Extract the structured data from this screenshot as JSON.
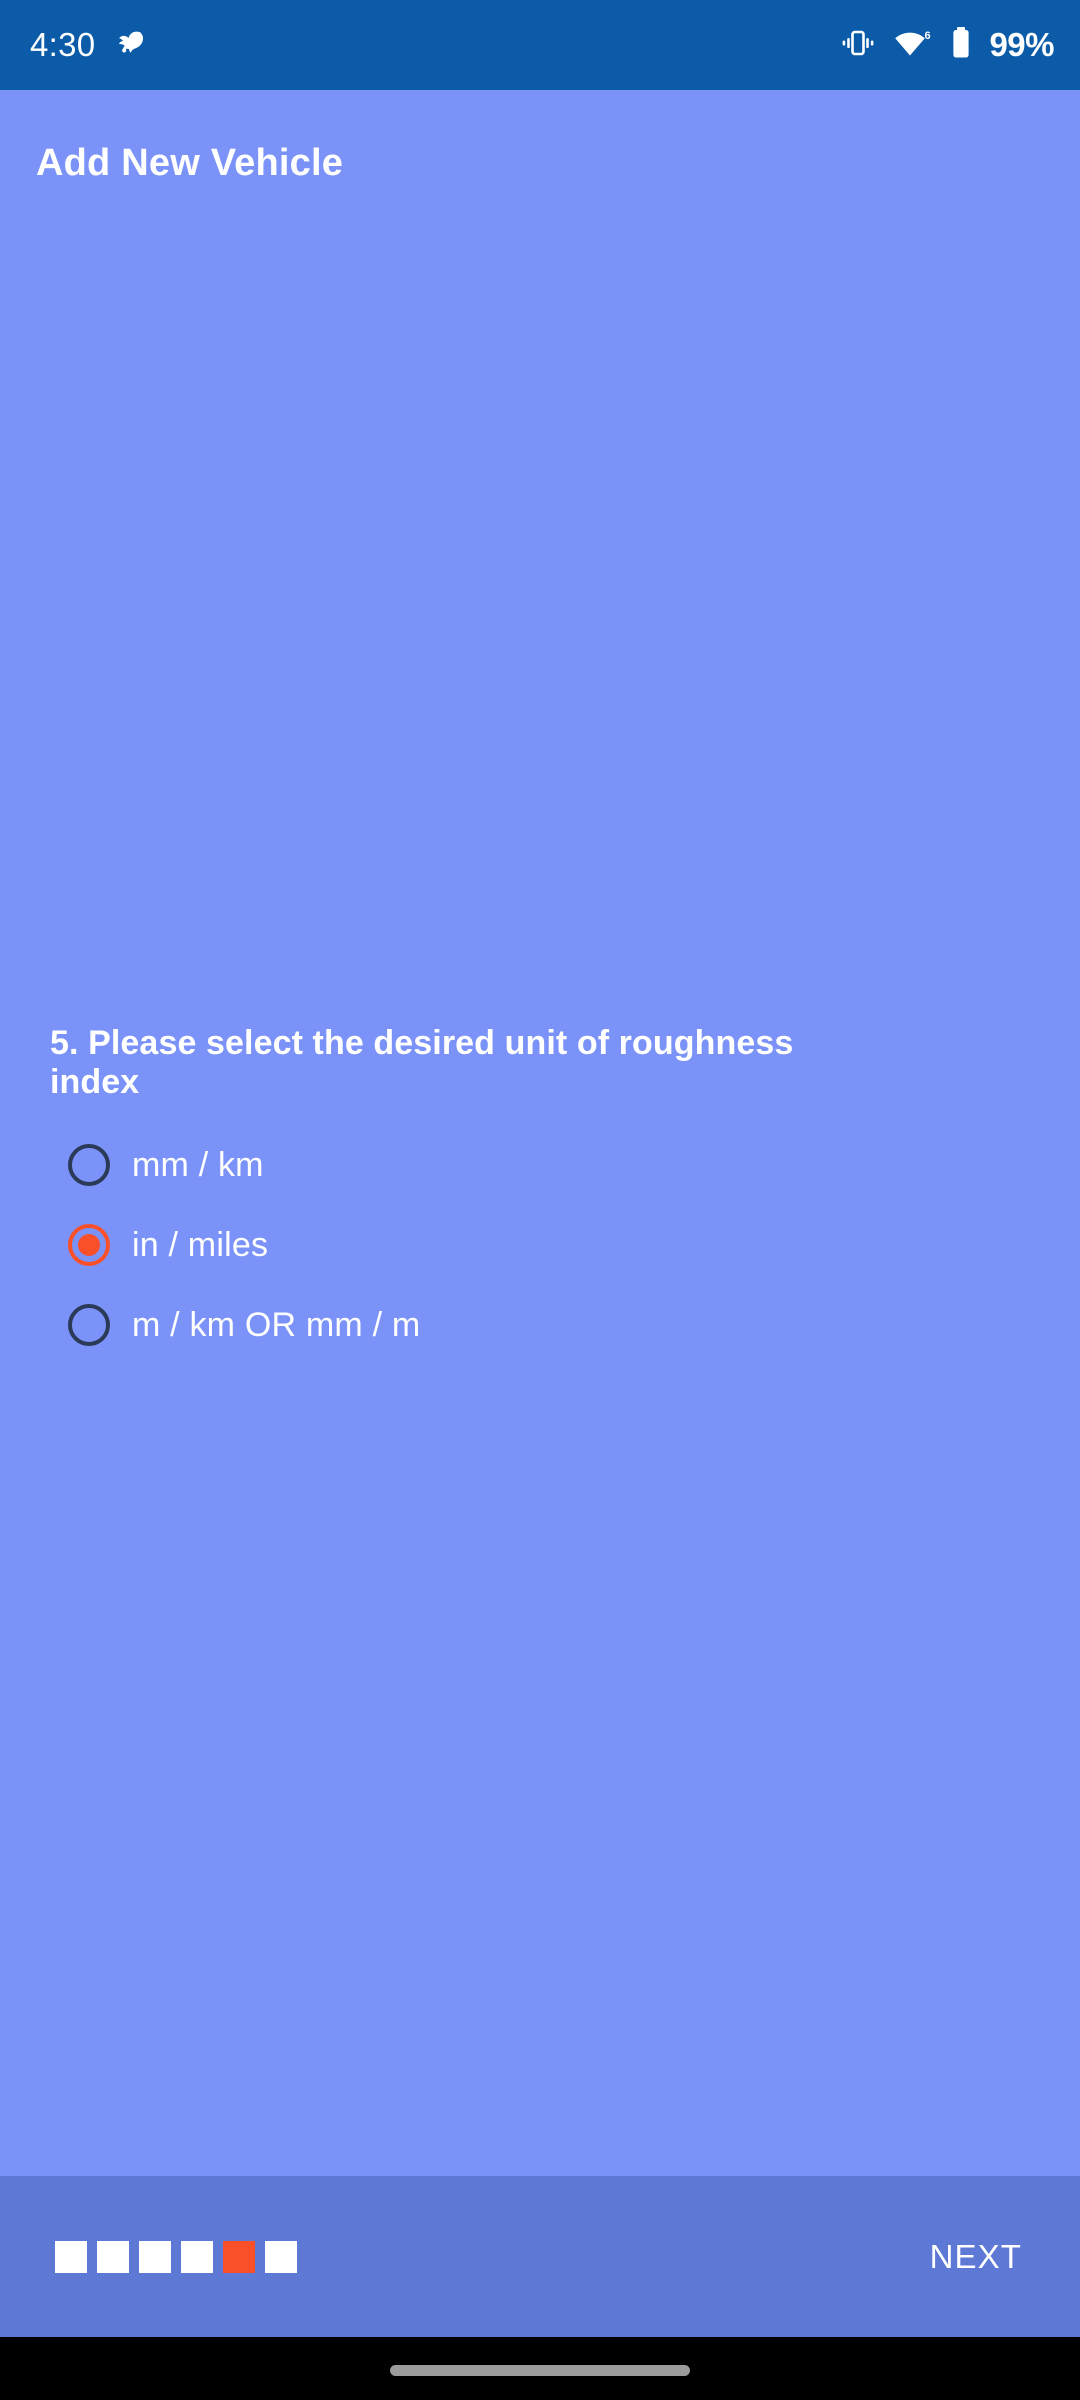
{
  "status_bar": {
    "time": "4:30",
    "notification_icon": "leaf-notification-icon",
    "vibrate_icon": "vibrate-icon",
    "wifi_icon": "wifi-6-icon",
    "wifi_generation": "6",
    "battery_icon": "battery-full-icon",
    "battery_percent": "99%",
    "background_color": "#0B5BA8"
  },
  "header": {
    "title": "Add New Vehicle"
  },
  "main": {
    "background_color": "#7B93F8",
    "question": {
      "number": "5.",
      "text": "5. Please select the desired unit of roughness index"
    },
    "options": [
      {
        "label": "mm / km",
        "selected": false
      },
      {
        "label": "in / miles",
        "selected": true
      },
      {
        "label": "m / km OR mm / m",
        "selected": false
      }
    ],
    "selected_value": "in / miles",
    "accent_color": "#F9502A",
    "radio_outline_color": "#2B3A57"
  },
  "bottom_bar": {
    "background_color": "#5E78D5",
    "next_label": "NEXT",
    "steps": {
      "total": 6,
      "current": 5
    }
  },
  "nav_bar": {
    "gesture_pill": "home-gesture-pill",
    "background_color": "#000000"
  }
}
